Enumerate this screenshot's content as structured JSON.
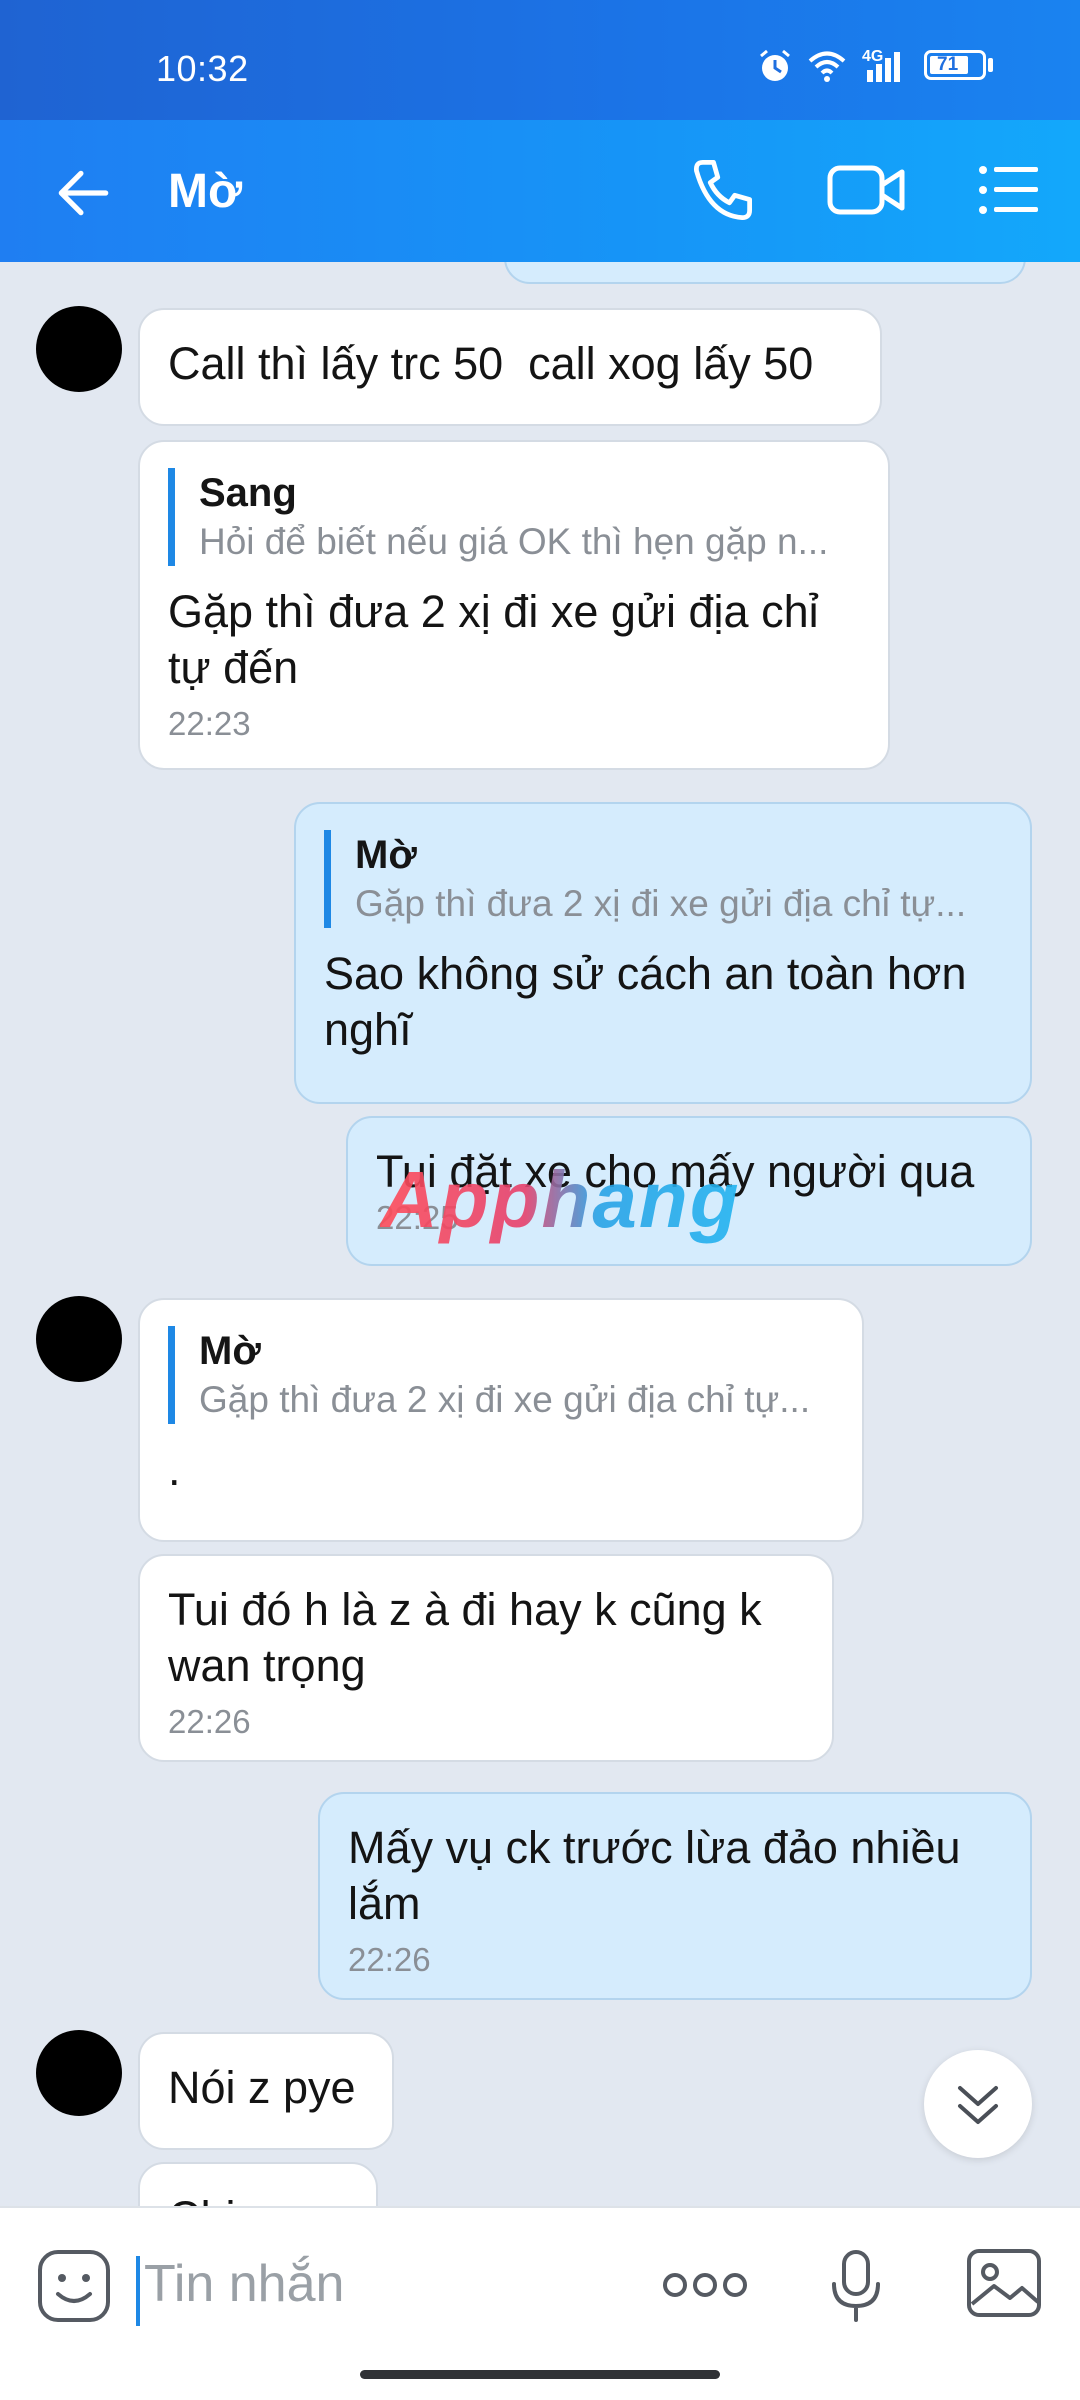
{
  "status": {
    "time": "10:32",
    "network": "4G",
    "battery": "71"
  },
  "header": {
    "title": "Mờ"
  },
  "messages": [
    {
      "text": "Call thì lấy trc 50  call xog lấy 50"
    },
    {
      "reply_name": "Sang",
      "reply_text": "Hỏi để biết nếu giá OK thì hẹn gặp n...",
      "text": "Gặp thì đưa 2 xị đi xe gửi địa chỉ\ntự đến",
      "time": "22:23"
    },
    {
      "reply_name": "Mờ",
      "reply_text": "Gặp thì đưa 2 xị đi xe gửi địa chỉ tự...",
      "text": "Sao không sử cách an toàn hơn\nnghĩ"
    },
    {
      "text": "Tui đặt xe cho mấy người qua",
      "time": "22:25"
    },
    {
      "reply_name": "Mờ",
      "reply_text": "Gặp thì đưa 2 xị đi xe gửi địa chỉ tự...",
      "text": "."
    },
    {
      "text": "Tui đó h là z à đi hay k cũng k\nwan trọng",
      "time": "22:26"
    },
    {
      "text": "Mấy vụ ck trước lừa đảo nhiều\nlắm",
      "time": "22:26"
    },
    {
      "text": "Nói z pye"
    },
    {
      "text": "Chị"
    }
  ],
  "watermark": "Apphang",
  "input": {
    "placeholder": "Tin nhắn"
  },
  "colors": {
    "accent": "#1e88e5",
    "bg": "#e2e8f1",
    "outgoing": "#d5ecfd"
  }
}
